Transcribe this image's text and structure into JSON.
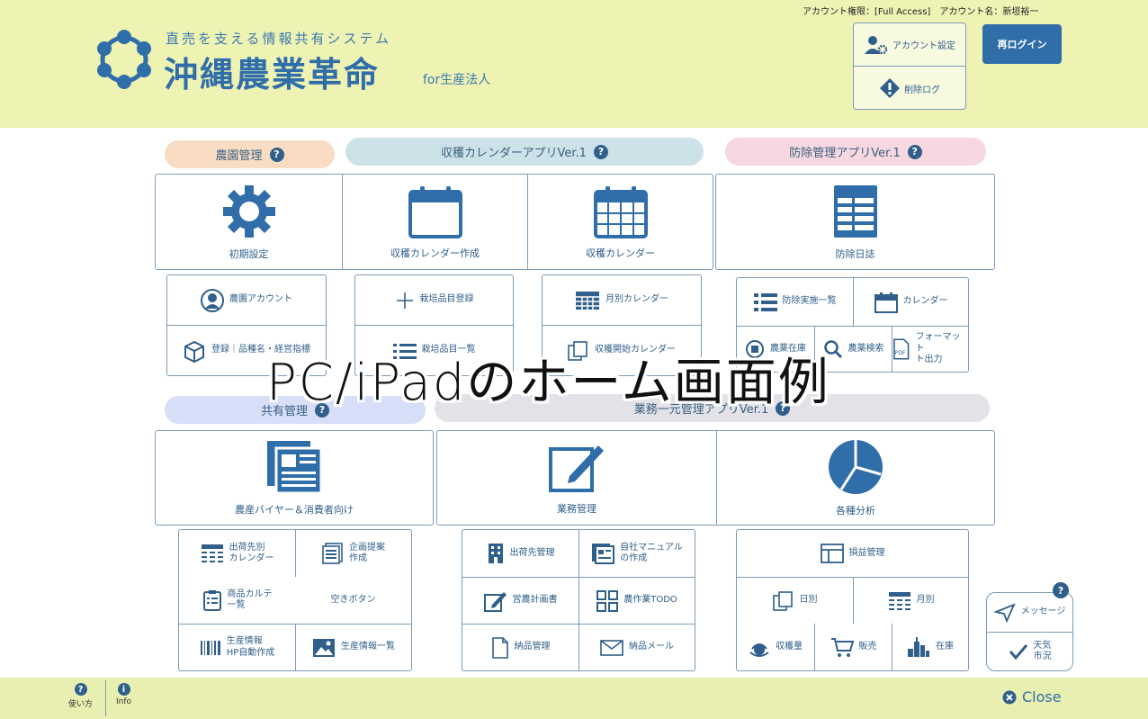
{
  "header": {
    "logo_sub": "直売を支える情報共有システム",
    "logo_main": "沖縄農業革命",
    "logo_for": "for生産法人",
    "account_info": "アカウント権限：[Full Access]　アカウント名：新垣裕一",
    "account_settings": "アカウント設定",
    "delete_log": "削除ログ",
    "relogin": "再ログイン"
  },
  "overlay_title": "PC/iPadのホーム画面例",
  "sections": {
    "farm": "農園管理",
    "harvest": "収穫カレンダーアプリVer.1",
    "pest": "防除管理アプリVer.1",
    "shared": "共有管理",
    "business": "業務一元管理アプリVer.1"
  },
  "big": {
    "initial": "初期設定",
    "harvest_create": "収穫カレンダー作成",
    "harvest_cal": "収穫カレンダー",
    "pest_diary": "防除日誌",
    "buyer": "農産バイヤー＆消費者向け",
    "business_mgmt": "業務管理",
    "analysis": "各種分析"
  },
  "farm_sub": {
    "account": "農園アカウント",
    "register": "登録｜品種名・経営指標"
  },
  "harvest_sub": {
    "crop_register": "栽培品目登録",
    "crop_list": "栽培品目一覧",
    "monthly": "月別カレンダー",
    "start_cal": "収穫開始カレンダー"
  },
  "pest_sub": {
    "list": "防除実施一覧",
    "calendar": "カレンダー",
    "stock": "農薬在庫",
    "search": "農薬検索",
    "format_1": "フォーマット",
    "format_2": "ト出力"
  },
  "shared_sub": {
    "ship_cal_1": "出荷先別",
    "ship_cal_2": "カレンダー",
    "plan_1": "企画提案",
    "plan_2": "作成",
    "karte_1": "商品カルテ",
    "karte_2": "一覧",
    "empty": "空きボタン",
    "auto_1": "生産情報",
    "auto_2": "HP自動作成",
    "info_list": "生産情報一覧"
  },
  "business_sub": {
    "ship_mgmt": "出荷先管理",
    "manual_1": "自社マニュアル",
    "manual_2": "の作成",
    "plan": "営農計画書",
    "todo": "農作業TODO",
    "delivery": "納品管理",
    "mail": "納品メール"
  },
  "analysis_sub": {
    "profit": "損益管理",
    "daily": "日別",
    "monthly": "月別",
    "yield": "収穫量",
    "sales": "販売",
    "stock": "在庫"
  },
  "side": {
    "message": "メッセージ",
    "weather_1": "天気",
    "weather_2": "市況"
  },
  "footer": {
    "howto": "使い方",
    "info": "Info",
    "close": "Close"
  }
}
